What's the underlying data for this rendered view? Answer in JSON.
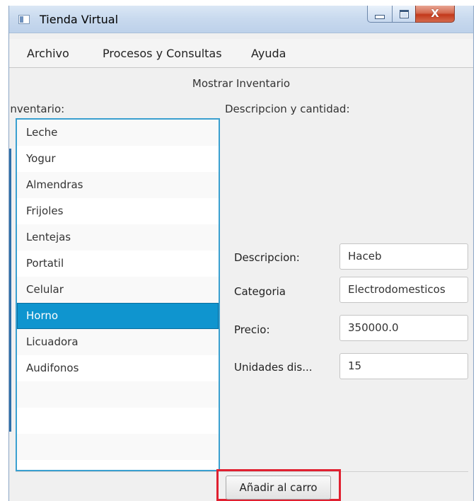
{
  "window": {
    "title": "Tienda Virtual",
    "close_glyph": "X"
  },
  "menu": {
    "archivo": "Archivo",
    "procesos": "Procesos y Consultas",
    "ayuda": "Ayuda"
  },
  "main": {
    "heading": "Mostrar Inventario",
    "inventory_label": "Inventario:",
    "description_label": "Descripcion y cantidad:"
  },
  "inventory": {
    "items": [
      "Leche",
      "Yogur",
      "Almendras",
      "Frijoles",
      "Lentejas",
      "Portatil",
      "Celular",
      "Horno",
      "Licuadora",
      "Audifonos",
      "",
      "",
      "",
      ""
    ],
    "selected": "Horno"
  },
  "details": {
    "descripcion_label": "Descripcion:",
    "descripcion_value": "Haceb",
    "categoria_label": "Categoria",
    "categoria_value": "Electrodomesticos",
    "precio_label": "Precio:",
    "precio_value": "350000.0",
    "unidades_label": "Unidades dis...",
    "unidades_value": "15"
  },
  "actions": {
    "add_to_cart": "Añadir al carro"
  },
  "colors": {
    "selection": "#0f95cf",
    "list_border": "#3aa0d0",
    "highlight_box": "#e02030"
  },
  "icons": {
    "app": "app-window-icon",
    "minimize": "minimize-icon",
    "maximize": "maximize-icon",
    "close": "close-icon"
  }
}
